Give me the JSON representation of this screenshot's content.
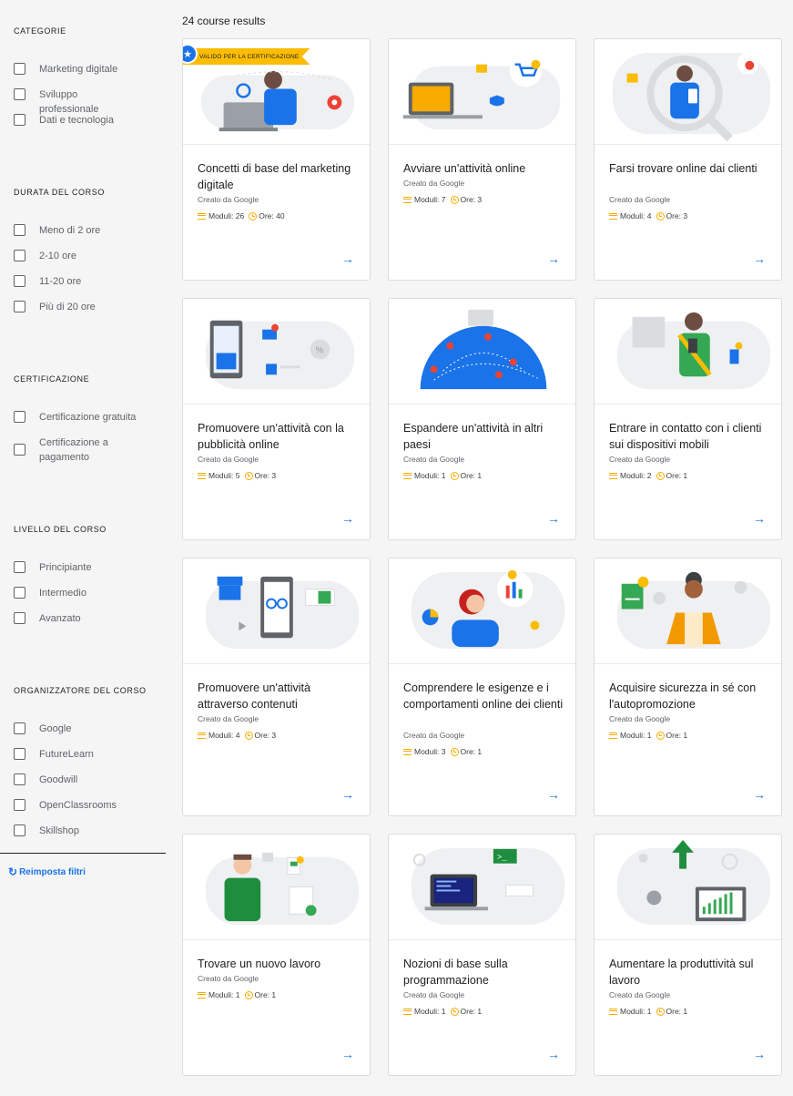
{
  "results": {
    "count_text": "24 course results"
  },
  "filters": {
    "categories": {
      "title": "CATEGORIE",
      "options": [
        "Marketing digitale",
        "Sviluppo professionale",
        "Dati e tecnologia"
      ]
    },
    "duration": {
      "title": "DURATA DEL CORSO",
      "options": [
        "Meno di 2 ore",
        "2-10 ore",
        "11-20 ore",
        "Più di 20 ore"
      ]
    },
    "certification": {
      "title": "CERTIFICAZIONE",
      "options": [
        "Certificazione gratuita",
        "Certificazione a pagamento"
      ]
    },
    "level": {
      "title": "LIVELLO DEL CORSO",
      "options": [
        "Principiante",
        "Intermedio",
        "Avanzato"
      ]
    },
    "organizer": {
      "title": "ORGANIZZATORE DEL CORSO",
      "options": [
        "Google",
        "FutureLearn",
        "Goodwill",
        "OpenClassrooms",
        "Skillshop"
      ]
    },
    "reset_label": "Reimposta filtri"
  },
  "badge_text": "VALIDO PER LA CERTIFICAZIONE",
  "courses": [
    {
      "title": "Concetti di base del marketing digitale",
      "by": "Creato da Google",
      "modules": "Moduli: 26",
      "hours": "Ore: 40",
      "certified": true
    },
    {
      "title": "Avviare un'attività online",
      "by": "Creato da Google",
      "modules": "Moduli: 7",
      "hours": "Ore: 3"
    },
    {
      "title": "Farsi trovare online dai clienti",
      "by": "Creato da Google",
      "modules": "Moduli: 4",
      "hours": "Ore: 3"
    },
    {
      "title": "Promuovere un'attività con la pubblicità online",
      "by": "Creato da Google",
      "modules": "Moduli: 5",
      "hours": "Ore: 3"
    },
    {
      "title": "Espandere un'attività in altri paesi",
      "by": "Creato da Google",
      "modules": "Moduli: 1",
      "hours": "Ore: 1"
    },
    {
      "title": "Entrare in contatto con i clienti sui dispositivi mobili",
      "by": "Creato da Google",
      "modules": "Moduli: 2",
      "hours": "Ore: 1"
    },
    {
      "title": "Promuovere un'attività attraverso contenuti",
      "by": "Creato da Google",
      "modules": "Moduli: 4",
      "hours": "Ore: 3"
    },
    {
      "title": "Comprendere le esigenze e i comportamenti online dei clienti",
      "by": "Creato da Google",
      "modules": "Moduli: 3",
      "hours": "Ore: 1"
    },
    {
      "title": "Acquisire sicurezza in sé con l'autopromozione",
      "by": "Creato da Google",
      "modules": "Moduli: 1",
      "hours": "Ore: 1"
    },
    {
      "title": "Trovare un nuovo lavoro",
      "by": "Creato da Google",
      "modules": "Moduli: 1",
      "hours": "Ore: 1"
    },
    {
      "title": "Nozioni di base sulla programmazione",
      "by": "Creato da Google",
      "modules": "Moduli: 1",
      "hours": "Ore: 1"
    },
    {
      "title": "Aumentare la produttività sul lavoro",
      "by": "Creato da Google",
      "modules": "Moduli: 1",
      "hours": "Ore: 1"
    }
  ],
  "colors": {
    "accent": "#1a73e8",
    "badge": "#fbbc04",
    "meta_icon": "#f9ab00"
  }
}
